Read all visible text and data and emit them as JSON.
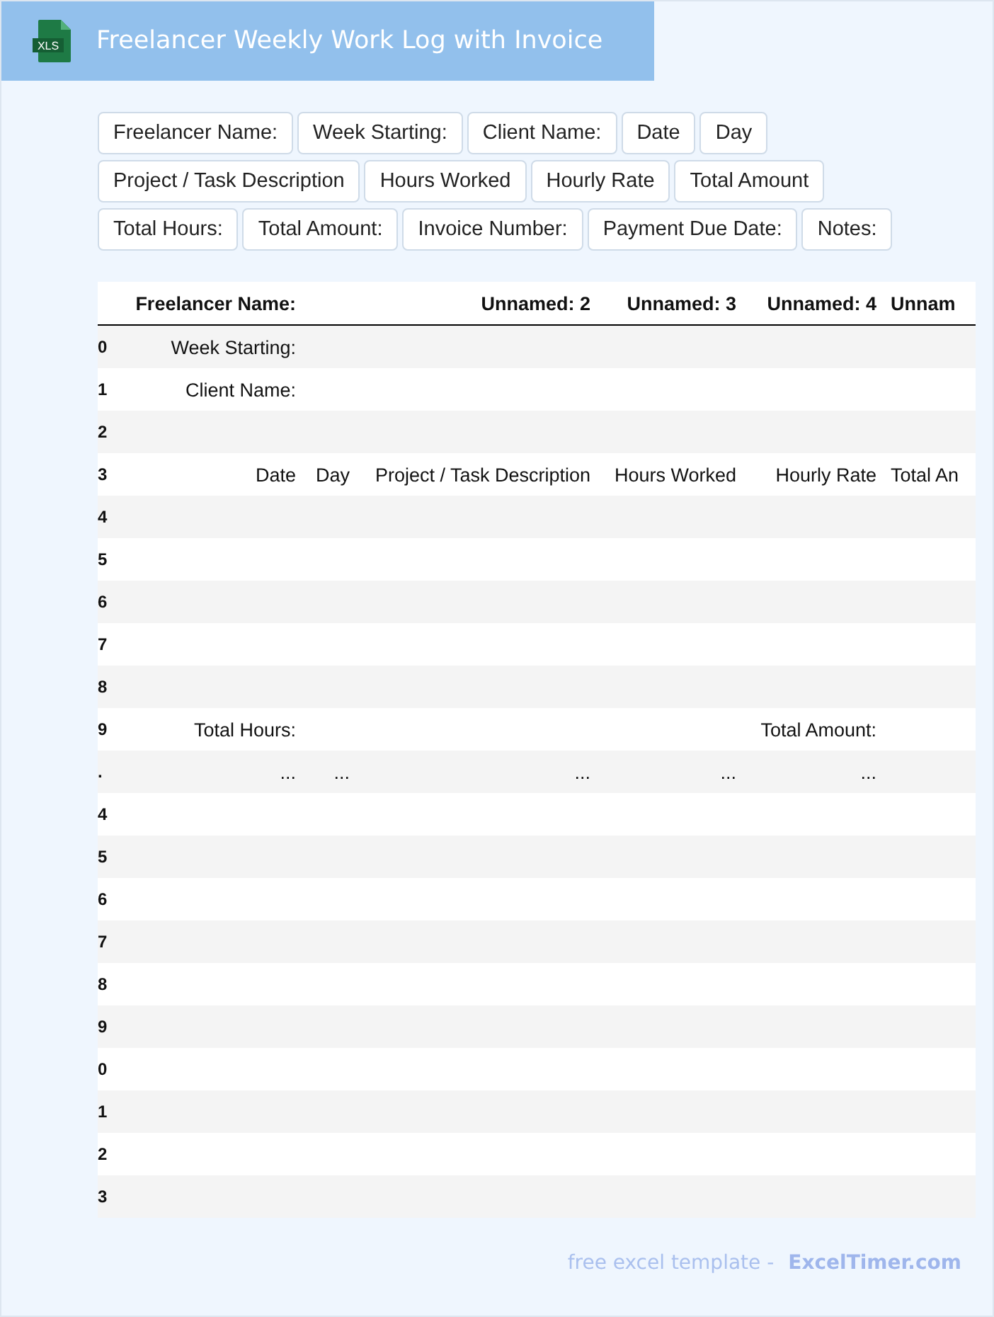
{
  "header": {
    "icon_text": "XLS",
    "title": "Freelancer Weekly Work Log with Invoice"
  },
  "chip_rows": [
    [
      "Freelancer Name:",
      "Week Starting:",
      "Client Name:",
      "Date",
      "Day"
    ],
    [
      "Project / Task Description",
      "Hours Worked",
      "Hourly Rate",
      "Total Amount"
    ],
    [
      "Total Hours:",
      "Total Amount:",
      "Invoice Number:",
      "Payment Due Date:",
      "Notes:"
    ]
  ],
  "table": {
    "columns": [
      "Freelancer Name:",
      null,
      "Unnamed: 2",
      "Unnamed: 3",
      "Unnamed: 4",
      "Unnam"
    ],
    "rows": [
      {
        "index": "0",
        "cells": [
          "Week Starting:",
          null,
          null,
          null,
          null,
          null
        ]
      },
      {
        "index": "1",
        "cells": [
          "Client Name:",
          null,
          null,
          null,
          null,
          null
        ]
      },
      {
        "index": "2",
        "cells": [
          null,
          null,
          null,
          null,
          null,
          null
        ]
      },
      {
        "index": "3",
        "cells": [
          "Date",
          "Day",
          "Project / Task Description",
          "Hours Worked",
          "Hourly Rate",
          "Total An"
        ]
      },
      {
        "index": "4",
        "cells": [
          null,
          null,
          null,
          null,
          null,
          null
        ]
      },
      {
        "index": "5",
        "cells": [
          null,
          null,
          null,
          null,
          null,
          null
        ]
      },
      {
        "index": "6",
        "cells": [
          null,
          null,
          null,
          null,
          null,
          null
        ]
      },
      {
        "index": "7",
        "cells": [
          null,
          null,
          null,
          null,
          null,
          null
        ]
      },
      {
        "index": "8",
        "cells": [
          null,
          null,
          null,
          null,
          null,
          null
        ]
      },
      {
        "index": "9",
        "cells": [
          "Total Hours:",
          null,
          null,
          null,
          "Total Amount:",
          null
        ]
      },
      {
        "index": ".",
        "cells": [
          "...",
          "...",
          "...",
          "...",
          "...",
          null
        ]
      },
      {
        "index": "4",
        "cells": [
          null,
          null,
          null,
          null,
          null,
          null
        ]
      },
      {
        "index": "5",
        "cells": [
          null,
          null,
          null,
          null,
          null,
          null
        ]
      },
      {
        "index": "6",
        "cells": [
          null,
          null,
          null,
          null,
          null,
          null
        ]
      },
      {
        "index": "7",
        "cells": [
          null,
          null,
          null,
          null,
          null,
          null
        ]
      },
      {
        "index": "8",
        "cells": [
          null,
          null,
          null,
          null,
          null,
          null
        ]
      },
      {
        "index": "9",
        "cells": [
          null,
          null,
          null,
          null,
          null,
          null
        ]
      },
      {
        "index": "0",
        "cells": [
          null,
          null,
          null,
          null,
          null,
          null
        ]
      },
      {
        "index": "1",
        "cells": [
          null,
          null,
          null,
          null,
          null,
          null
        ]
      },
      {
        "index": "2",
        "cells": [
          null,
          null,
          null,
          null,
          null,
          null
        ]
      },
      {
        "index": "3",
        "cells": [
          null,
          null,
          null,
          null,
          null,
          null
        ]
      }
    ]
  },
  "footer": {
    "text": "free excel template -",
    "link": "ExcelTimer.com"
  }
}
